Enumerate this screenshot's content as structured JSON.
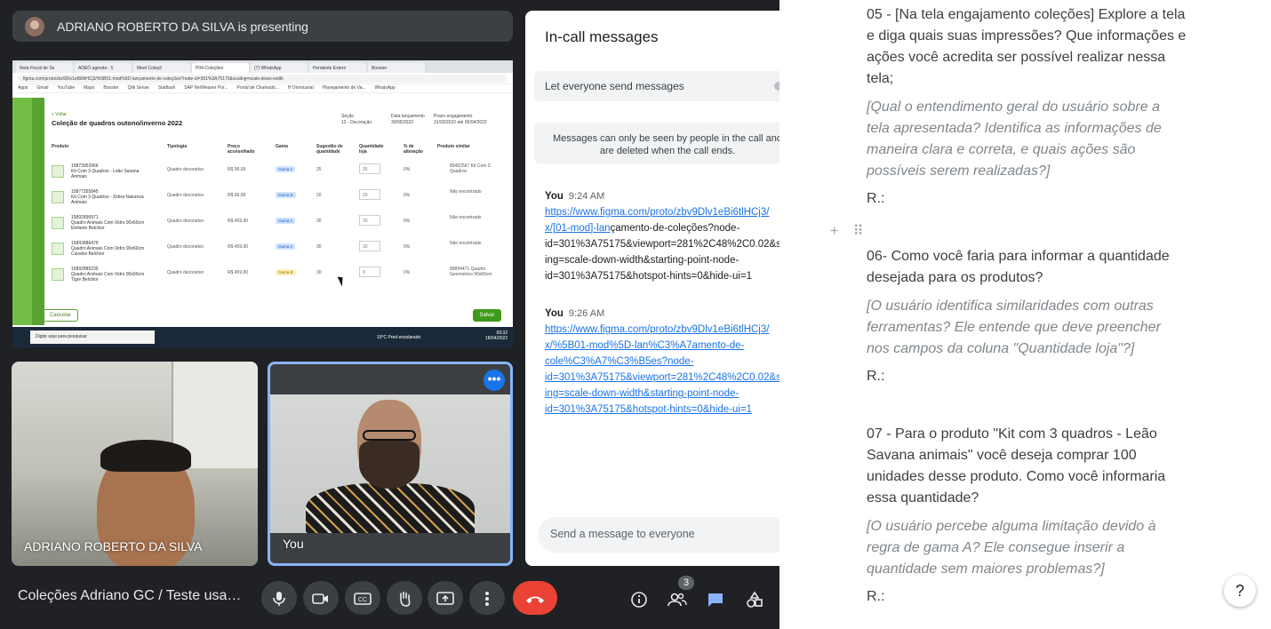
{
  "presenter": {
    "text": "ADRIANO ROBERTO DA SILVA is presenting"
  },
  "shared_screen": {
    "tabs": [
      "Nota Fiscal de Se",
      "ADEO agenda - 5",
      "Meet Coleçõ",
      "P04-Coleções",
      "(7) WhatsApp",
      "Pendente Extern",
      "Booster"
    ],
    "url": "figma.com/proto/zbv9Dlv1eBi6tlHCj3/%5B01-mod%5D-lançamento-de-coleções?node-id=301%3A75175&scaling=scale-down-width",
    "bookmarks": [
      "Apps",
      "Gmail",
      "YouTube",
      "Maps",
      "Booster",
      "Qlik Sense",
      "Statflash",
      "SAP NetWeaver Por...",
      "Portal de Chamado...",
      "H Omnicanal",
      "Planejamento de Va...",
      "WhatsApp"
    ],
    "back": "< Voltar",
    "title": "Coleção de quadros outono/inverno 2022",
    "meta": [
      {
        "label": "Seção",
        "value": "12 - Decoração"
      },
      {
        "label": "Data lançamento",
        "value": "30/05/2022"
      },
      {
        "label": "Prazo engajamento",
        "value": "31/03/2022 até 05/04/2022"
      }
    ],
    "columns": [
      "Produto",
      "Tipologia",
      "Preço aconselhado",
      "Gama",
      "Sugestão de quantidade",
      "Quantidade loja",
      "% de alteração",
      "Produto similar"
    ],
    "rows": [
      {
        "code": "15873952966",
        "name": "Kit Com 3 Quadros - Leão Savana Animais",
        "type": "Quadro decorativo",
        "price": "R$ 99,99",
        "gama": "Gama A",
        "sug": "25",
        "qty": "25",
        "pct": "0%",
        "sim": "89452567 Kit Com 3 Quadros"
      },
      {
        "code": "15877355845",
        "name": "Kit Com 3 Quadros - Zebra Natureza Animais",
        "type": "Quadro decorativo",
        "price": "R$ 99,99",
        "gama": "Gama B",
        "sug": "20",
        "qty": "20",
        "pct": "0%",
        "sim": "Não encontrado"
      },
      {
        "code": "15892896971",
        "name": "Quadro Animais Com Vidro 90x60cm Elefante Belchior",
        "type": "Quadro decorativo",
        "price": "R$ 459,90",
        "gama": "Gama A",
        "sug": "30",
        "qty": "30",
        "pct": "0%",
        "sim": "Não encontrado"
      },
      {
        "code": "15892886479",
        "name": "Quadro Animais Com Vidro 90x60cm Cavalos Belchior",
        "type": "Quadro decorativo",
        "price": "R$ 459,90",
        "gama": "Gama A",
        "sug": "30",
        "qty": "30",
        "pct": "0%",
        "sim": "Não encontrado"
      },
      {
        "code": "15892885235",
        "name": "Quadro Animais Com Vidro 90x60cm Tigre Belchior",
        "type": "Quadro decorativo",
        "price": "R$ 459,90",
        "gama": "Gama B",
        "sug": "30",
        "qty": "0",
        "pct": "0%",
        "sim": "89894471 Quadro Geometrico 90x60cm"
      }
    ],
    "cancel": "Cancelar",
    "save": "Salvar",
    "taskbar_search": "Digite aqui para pesquisar",
    "weather": "19°C Pred ensolarado",
    "clock_time": "09:32",
    "clock_date": "18/04/2022"
  },
  "tiles": {
    "adriano": "ADRIANO ROBERTO DA SILVA",
    "you": "You",
    "more": "•••"
  },
  "chat": {
    "title": "In-call messages",
    "toggle_label": "Let everyone send messages",
    "notice": "Messages can only be seen by people in the call and are deleted when the call ends.",
    "messages": [
      {
        "sender": "You",
        "time": "9:24 AM",
        "lines": [
          "https://www.figma.com/proto/zbv9Dlv1eBi6tlHCj3/",
          "x/[01-mod]-lan",
          "çamento-de-coleções?node-",
          "id=301%3A75175&viewport=281%2C48%2C0.02&s",
          "ing=scale-down-width&starting-point-node-",
          "id=301%3A75175&hotspot-hints=0&hide-ui=1"
        ]
      },
      {
        "sender": "You",
        "time": "9:26 AM",
        "lines": [
          "https://www.figma.com/proto/zbv9Dlv1eBi6tlHCj3/",
          "x/%5B01-mod%5D-lan%C3%A7amento-de-",
          "cole%C3%A7%C3%B5es?node-",
          "id=301%3A75175&viewport=281%2C48%2C0.02&s",
          "ing=scale-down-width&starting-point-node-",
          "id=301%3A75175&hotspot-hints=0&hide-ui=1"
        ]
      }
    ],
    "input_placeholder": "Send a message to everyone"
  },
  "doc": {
    "q5": "05 - [Na tela engajamento coleções] Explore a tela e diga quais suas impressões? Que informações e ações você acredita ser possível realizar nessa tela;",
    "n5": "[Qual o entendimento geral do usuário sobre a tela apresentada? Identifica as informações de maneira clara e correta, e quais ações são possíveis serem realizadas?]",
    "r5": "R.:",
    "q6": "06- Como você faria para informar a quantidade desejada para os produtos?",
    "n6": "[O usuário identifica similaridades com outras ferramentas? Ele entende que deve preencher nos campos da coluna \"Quantidade loja\"?]",
    "r6": "R.:",
    "q7": "07 - Para o produto \"Kit com 3 quadros - Leão Savana animais\" você deseja comprar 100 unidades desse produto. Como você informaria essa quantidade?",
    "n7": "[O usuário percebe alguma limitação devido à regra de gama A? Ele consegue inserir a quantidade sem maiores problemas?]",
    "r7": "R.:",
    "help": "?"
  },
  "bottom_bar": {
    "meeting_name": "Coleções Adriano GC / Teste usabili...",
    "participants_count": "3",
    "icons": [
      "microphone-icon",
      "camera-icon",
      "captions-icon",
      "raise-hand-icon",
      "present-icon",
      "more-options-icon",
      "end-call-icon",
      "info-icon",
      "people-icon",
      "chat-icon",
      "activities-icon"
    ]
  },
  "colors": {
    "meet_bg": "#202124",
    "accent_blue": "#8ab4f8",
    "end_call_red": "#ea4335",
    "figma_green": "#73bf45"
  }
}
